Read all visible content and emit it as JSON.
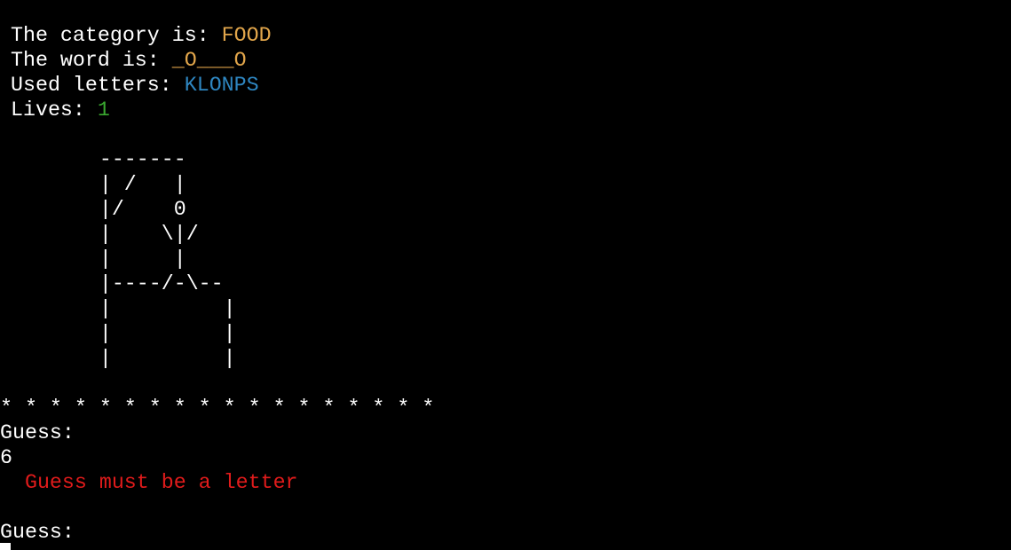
{
  "status": {
    "category_label": "The category is: ",
    "category_value": "FOOD",
    "word_label": "The word is: ",
    "word_value": "_O___O",
    "used_label": "Used letters: ",
    "used_value": "KLONPS",
    "lives_label": "Lives: ",
    "lives_value": "1"
  },
  "gallows": [
    "        -------",
    "        | /   |",
    "        |/    0",
    "        |    \\|/",
    "        |     |",
    "        |----/-\\--",
    "        |         |",
    "        |         |",
    "        |         |"
  ],
  "separator": "* * * * * * * * * * * * * * * * * *",
  "session": {
    "prompt1": "Guess:",
    "input1": "6",
    "error": "  Guess must be a letter",
    "prompt2": "Guess:"
  },
  "colors": {
    "background": "#000000",
    "text": "#ffffff",
    "category": "#e2a64b",
    "word": "#e2a64b",
    "used_letters": "#2e86c1",
    "lives": "#3aa830",
    "error": "#e01b1b"
  }
}
